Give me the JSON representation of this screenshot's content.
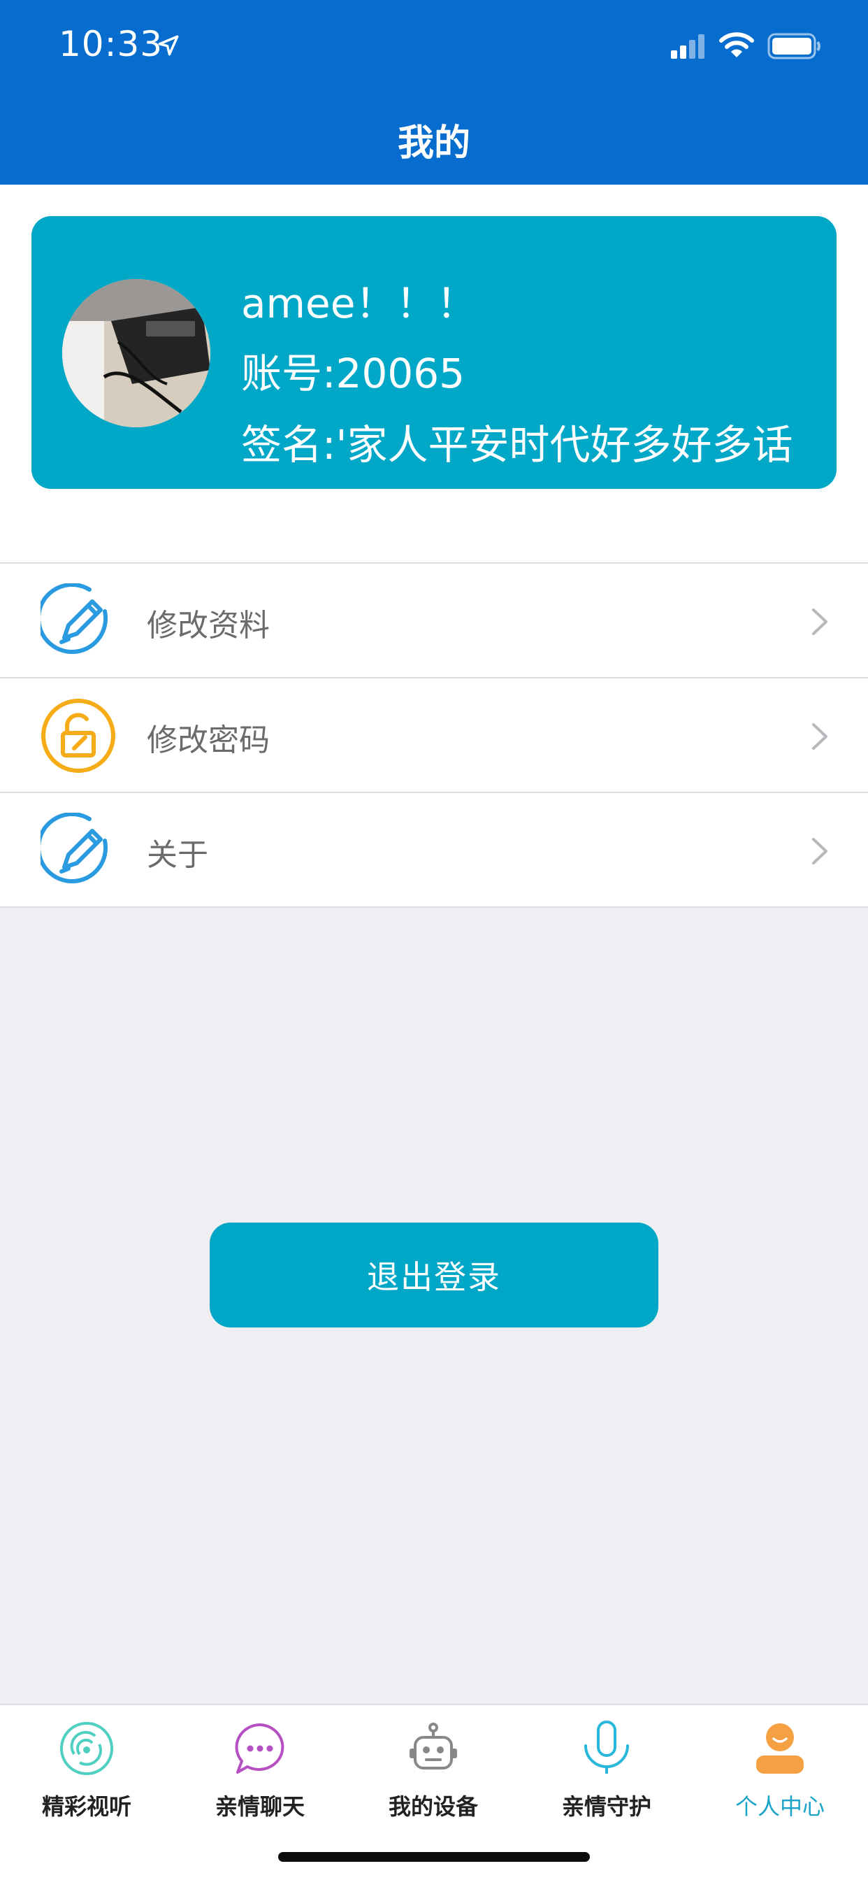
{
  "status_bar": {
    "time": "10:33"
  },
  "header": {
    "title": "我的"
  },
  "profile": {
    "name": "amee！！！",
    "account": "账号:20065",
    "signature": "签名:'家人平安时代好多好多话"
  },
  "menu": {
    "items": [
      {
        "label": "修改资料",
        "icon": "edit-pencil-icon"
      },
      {
        "label": "修改密码",
        "icon": "unlock-icon"
      },
      {
        "label": "关于",
        "icon": "edit-pencil-icon"
      }
    ]
  },
  "logout": {
    "label": "退出登录"
  },
  "tabbar": {
    "items": [
      {
        "label": "精彩视听",
        "icon": "broadcast-icon"
      },
      {
        "label": "亲情聊天",
        "icon": "chat-bubble-icon"
      },
      {
        "label": "我的设备",
        "icon": "robot-icon"
      },
      {
        "label": "亲情守护",
        "icon": "microphone-icon"
      },
      {
        "label": "个人中心",
        "icon": "person-icon"
      }
    ],
    "active_index": 4
  },
  "colors": {
    "header_blue": "#066dcf",
    "accent_teal": "#00a7c7",
    "active_tab": "#1ba4c8",
    "icon_blue": "#2a9be0",
    "icon_orange": "#f6ac17"
  }
}
